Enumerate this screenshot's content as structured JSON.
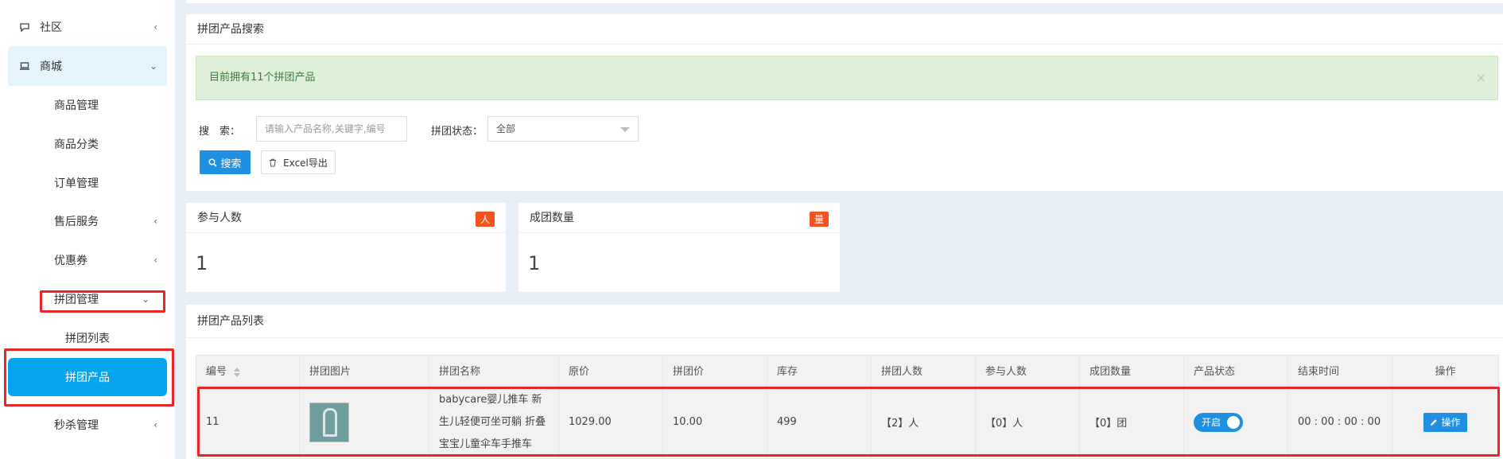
{
  "sidebar": {
    "community": "社区",
    "mall": "商城",
    "items": [
      {
        "label": "商品管理"
      },
      {
        "label": "商品分类"
      },
      {
        "label": "订单管理"
      },
      {
        "label": "售后服务"
      },
      {
        "label": "优惠券"
      },
      {
        "label": "拼团管理"
      },
      {
        "label": "拼团列表"
      },
      {
        "label": "拼团产品"
      },
      {
        "label": "秒杀管理"
      }
    ]
  },
  "search_card": {
    "title": "拼团产品搜索",
    "alert": "目前拥有11个拼团产品",
    "search_label": "搜　索：",
    "search_placeholder": "请输入产品名称,关键字,编号",
    "status_label": "拼团状态：",
    "status_value": "全部",
    "search_button": "搜索",
    "export_button": "Excel导出"
  },
  "stats": [
    {
      "title": "参与人数",
      "badge": "人",
      "value": "1",
      "badge_color": "#f5541f"
    },
    {
      "title": "成团数量",
      "badge": "量",
      "value": "1",
      "badge_color": "#f5541f"
    }
  ],
  "list": {
    "title": "拼团产品列表",
    "columns": [
      "编号",
      "拼团图片",
      "拼团名称",
      "原价",
      "拼团价",
      "库存",
      "拼团人数",
      "参与人数",
      "成团数量",
      "产品状态",
      "结束时间",
      "操作"
    ],
    "rows": [
      {
        "id": "11",
        "name": "babycare婴儿推车 新生儿轻便可坐可躺 折叠宝宝儿童伞车手推车",
        "price": "1029.00",
        "group_price": "10.00",
        "stock": "499",
        "group_size": "【2】人",
        "participants": "【0】人",
        "groups": "【0】团",
        "status": "开启",
        "end_time": "00 : 00 : 00 : 00",
        "action": "操作"
      }
    ]
  },
  "colors": {
    "accent": "#1e8fe1",
    "sidebar_active": "#05a6ee",
    "highlight": "#e5262b"
  }
}
